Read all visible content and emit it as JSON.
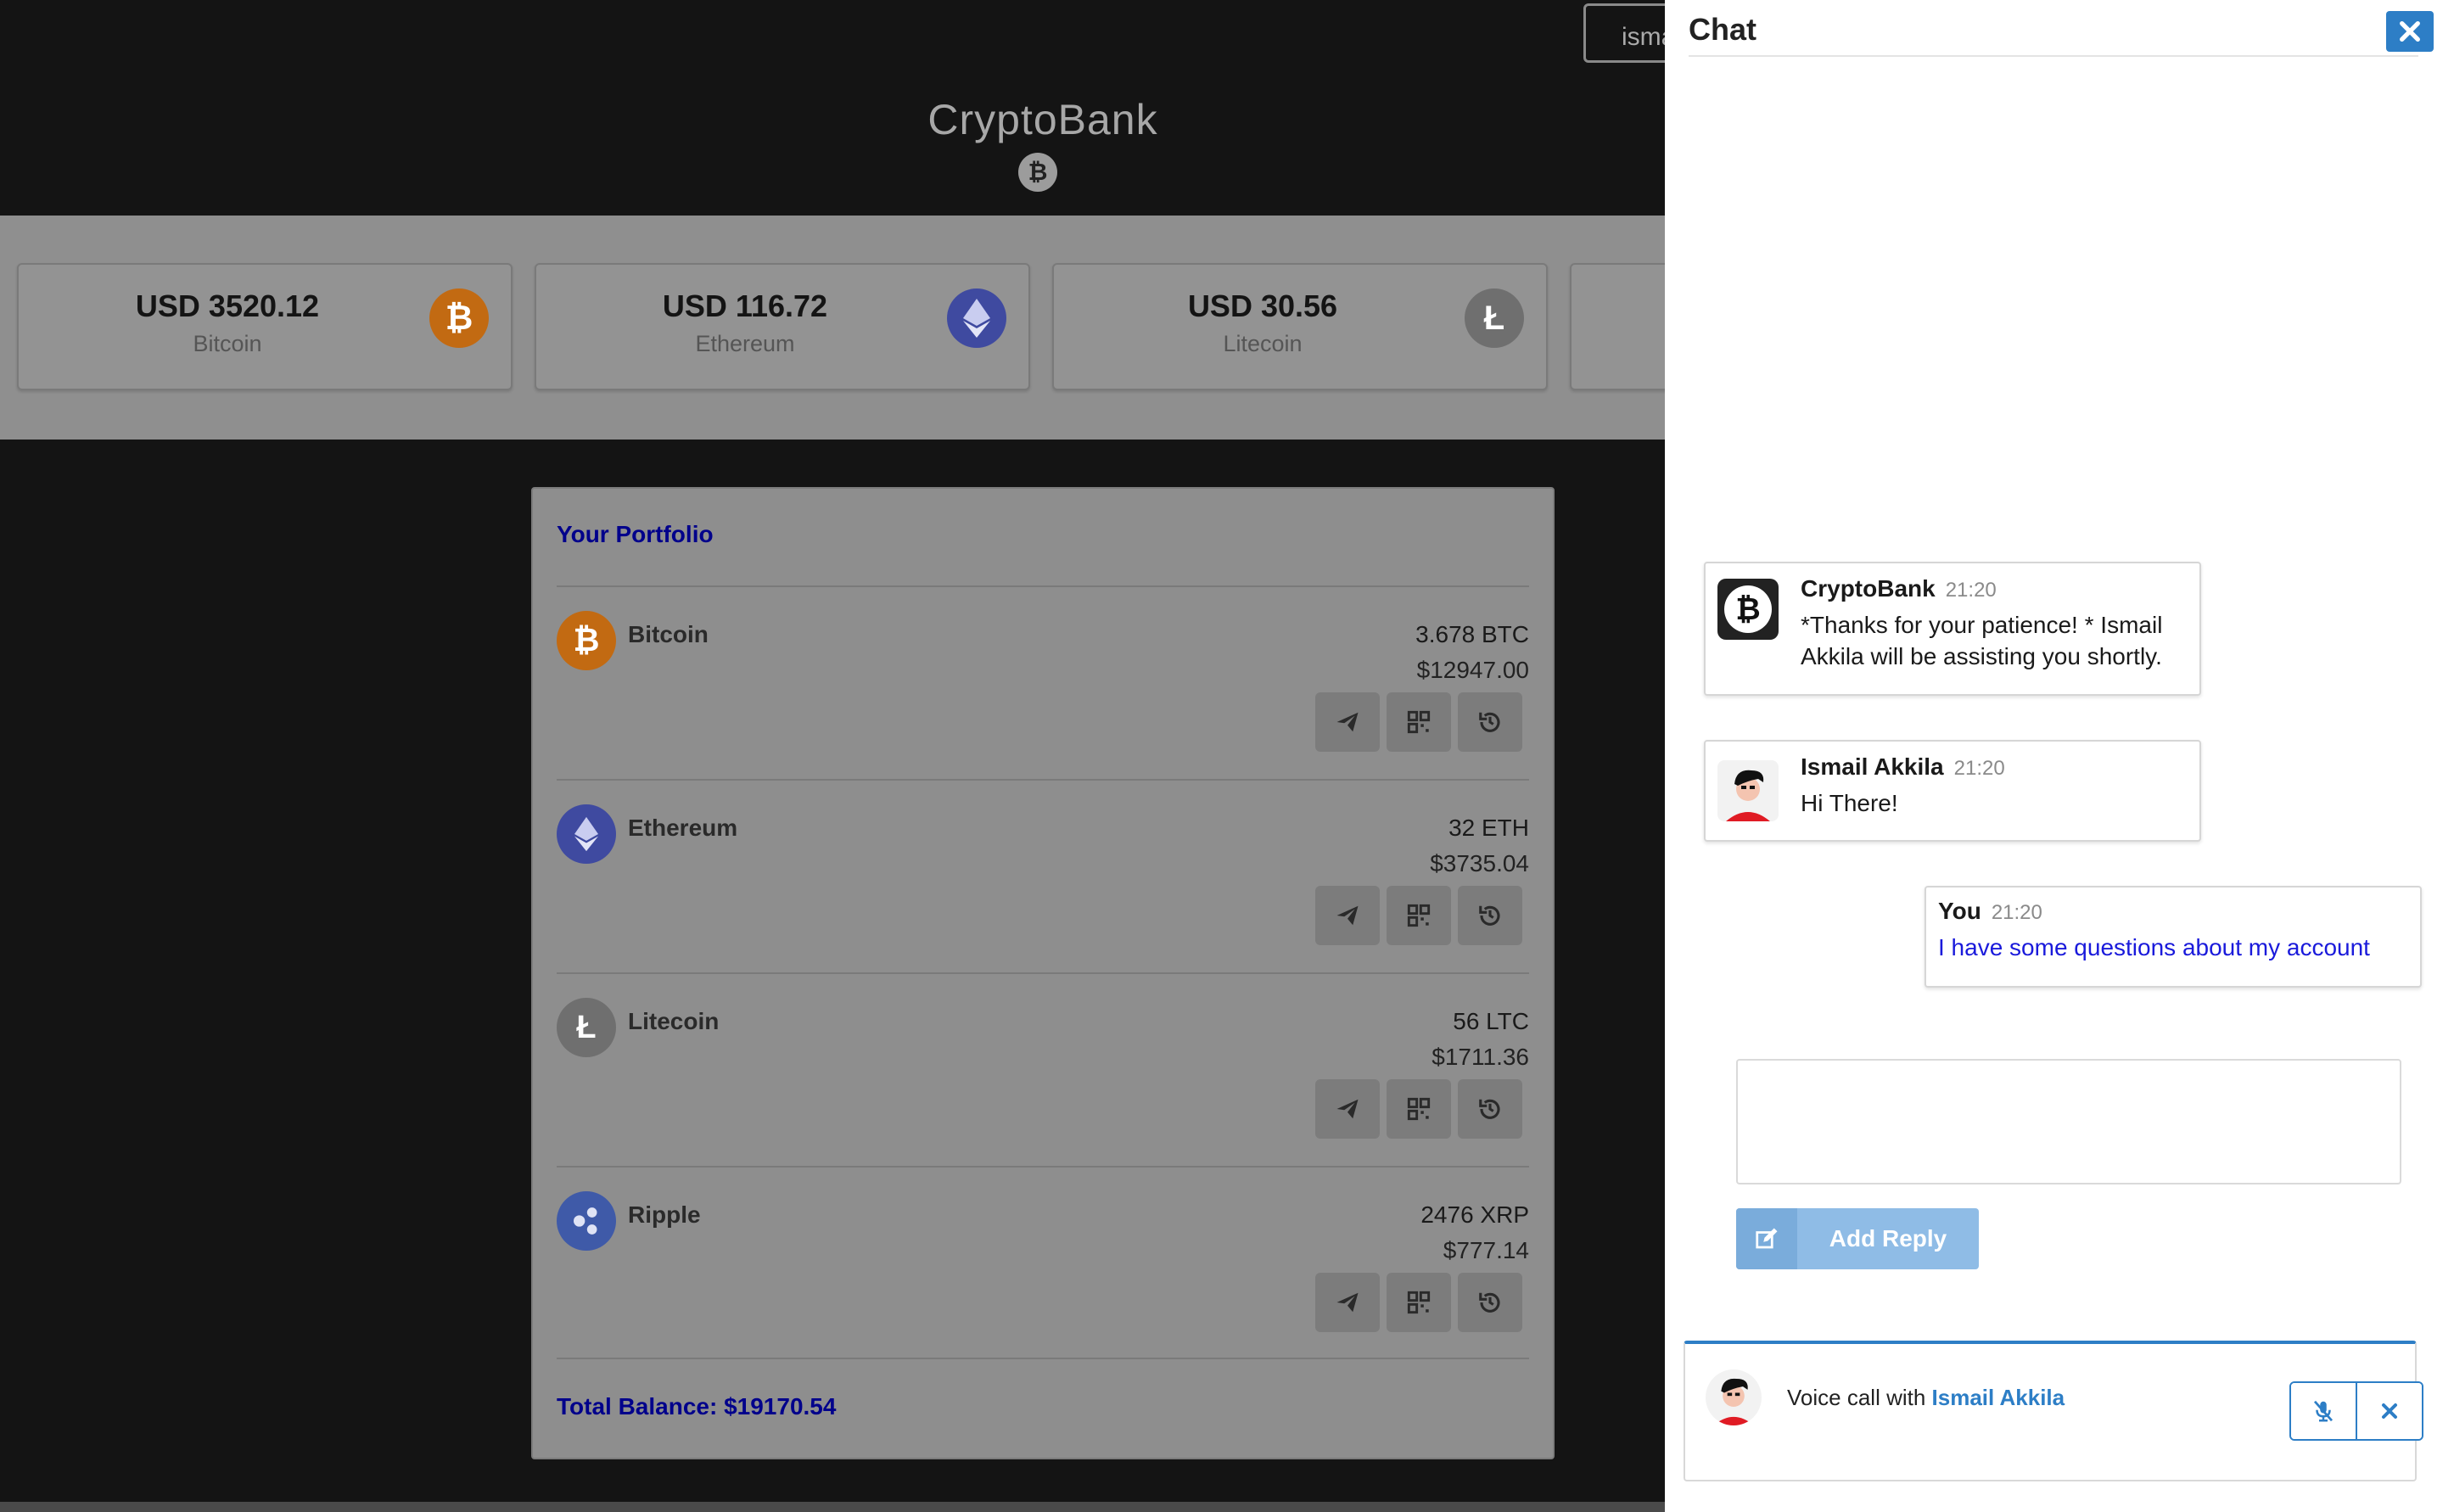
{
  "header": {
    "brand": "CryptoBank",
    "user_button": "isma"
  },
  "tickers": [
    {
      "price": "USD 3520.12",
      "coin": "Bitcoin",
      "icon": "bitcoin-icon",
      "color": "#c26a12"
    },
    {
      "price": "USD 116.72",
      "coin": "Ethereum",
      "icon": "ethereum-icon",
      "color": "#3f4aa0"
    },
    {
      "price": "USD 30.56",
      "coin": "Litecoin",
      "icon": "litecoin-icon",
      "color": "#6f6f6f"
    }
  ],
  "portfolio": {
    "title": "Your Portfolio",
    "rows": [
      {
        "name": "Bitcoin",
        "amount": "3.678 BTC",
        "usd": "$12947.00",
        "icon": "bitcoin-icon",
        "color": "#c26a12"
      },
      {
        "name": "Ethereum",
        "amount": "32 ETH",
        "usd": "$3735.04",
        "icon": "ethereum-icon",
        "color": "#3f4aa0"
      },
      {
        "name": "Litecoin",
        "amount": "56 LTC",
        "usd": "$1711.36",
        "icon": "litecoin-icon",
        "color": "#6f6f6f"
      },
      {
        "name": "Ripple",
        "amount": "2476 XRP",
        "usd": "$777.14",
        "icon": "ripple-icon",
        "color": "#3f5aa8"
      }
    ],
    "total": "Total Balance: $19170.54"
  },
  "chat": {
    "title": "Chat",
    "messages": [
      {
        "author": "CryptoBank",
        "time": "21:20",
        "text": "*Thanks for your patience! * Ismail Akkila will be assisting you shortly."
      },
      {
        "author": "Ismail Akkila",
        "time": "21:20",
        "text": "Hi There!"
      },
      {
        "author": "You",
        "time": "21:20",
        "text": "I have some questions about my account"
      }
    ],
    "reply_input_value": "",
    "reply_button": "Add Reply",
    "voice_call": {
      "prefix": "Voice call with ",
      "name": "Ismail Akkila"
    }
  },
  "colors": {
    "accent": "#2d7ec6",
    "portfolio_link": "#00008b",
    "own_message_text": "#1a1adb"
  }
}
